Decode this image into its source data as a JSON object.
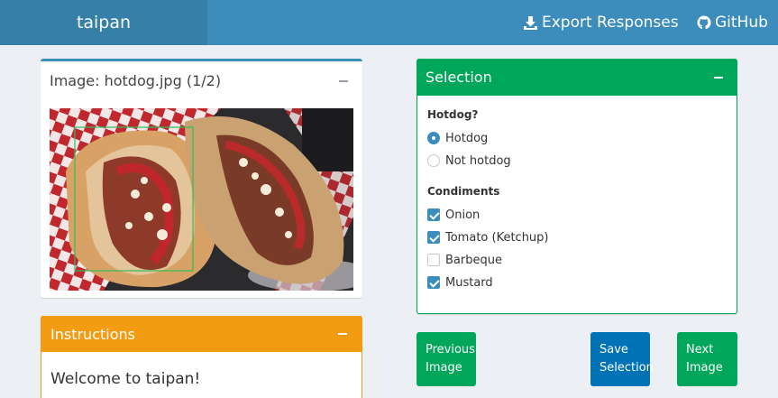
{
  "header": {
    "brand": "taipan",
    "export_label": "Export Responses",
    "github_label": "GitHub"
  },
  "image_box": {
    "title": "Image: hotdog.jpg (1/2)",
    "image_alt": "hotdogs photo with bounding box"
  },
  "instructions_box": {
    "title": "Instructions",
    "welcome": "Welcome to taipan!"
  },
  "selection_box": {
    "title": "Selection",
    "hotdog_question": "Hotdog?",
    "hotdog_options": [
      {
        "label": "Hotdog",
        "selected": true
      },
      {
        "label": "Not hotdog",
        "selected": false
      }
    ],
    "condiments_label": "Condiments",
    "condiments": [
      {
        "label": "Onion",
        "checked": true
      },
      {
        "label": "Tomato (Ketchup)",
        "checked": true
      },
      {
        "label": "Barbeque",
        "checked": false
      },
      {
        "label": "Mustard",
        "checked": true
      }
    ]
  },
  "buttons": {
    "prev_line1": "Previous",
    "prev_line2": "Image",
    "save_line1": "Save",
    "save_line2": "Selection",
    "next_line1": "Next",
    "next_line2": "Image"
  },
  "colors": {
    "header": "#3c8dbc",
    "brand": "#367fa9",
    "selection": "#00a65a",
    "instructions": "#f39c12",
    "save": "#0073b7"
  }
}
